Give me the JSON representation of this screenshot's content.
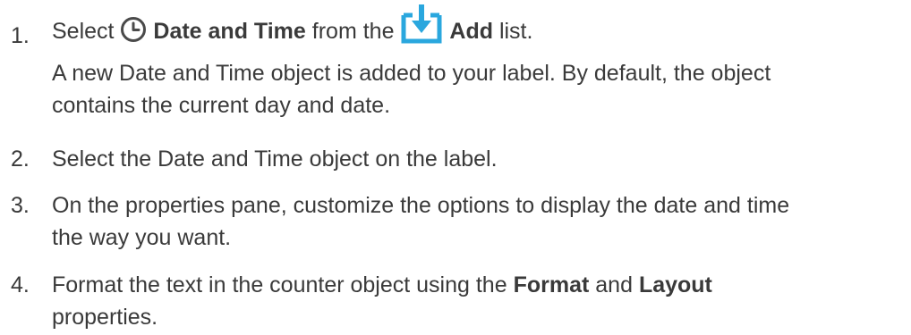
{
  "steps": [
    {
      "number": "1.",
      "select_word": "Select",
      "clock_icon": "clock-icon",
      "date_time_label": "Date and Time",
      "from_the": "from the",
      "add_icon": "add-download-icon",
      "add_label": "Add",
      "list_word": "list.",
      "description_line1": "A new Date and Time object is added to your label. By default, the object",
      "description_line2": "contains the current day and date."
    },
    {
      "number": "2.",
      "text": "Select the Date and Time object on the label."
    },
    {
      "number": "3.",
      "line1": "On the properties pane, customize the options to display the date and time",
      "line2": "the way you want."
    },
    {
      "number": "4.",
      "prefix": "Format the text in the counter object using the",
      "format_label": "Format",
      "and_word": "and",
      "layout_label": "Layout",
      "line2": "properties."
    }
  ],
  "colors": {
    "text": "#3a3a3a",
    "accent_blue": "#2aa7de"
  }
}
